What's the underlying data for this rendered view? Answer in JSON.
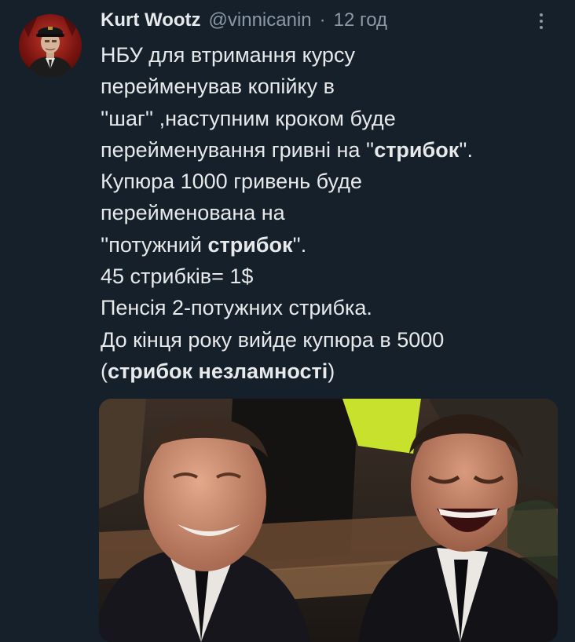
{
  "tweet": {
    "author_name": "Kurt Wootz",
    "handle": "@vinnicanin",
    "separator": "·",
    "time": "12 год",
    "more_icon": "more-vertical-icon",
    "lines": [
      {
        "parts": [
          {
            "text": "НБУ для втримання курсу",
            "bold": false
          }
        ]
      },
      {
        "parts": [
          {
            "text": "перейменував копійку в",
            "bold": false
          }
        ]
      },
      {
        "parts": [
          {
            "text": "''шаг'' ,наступним кроком буде",
            "bold": false
          }
        ]
      },
      {
        "parts": [
          {
            "text": "перейменування гривні на ''",
            "bold": false
          },
          {
            "text": "стрибок",
            "bold": true
          },
          {
            "text": "''.",
            "bold": false
          }
        ]
      },
      {
        "parts": [
          {
            "text": "Купюра 1000 гривень буде",
            "bold": false
          }
        ]
      },
      {
        "parts": [
          {
            "text": "перейменована на",
            "bold": false
          }
        ]
      },
      {
        "parts": [
          {
            "text": "''потужний ",
            "bold": false
          },
          {
            "text": "стрибок",
            "bold": true
          },
          {
            "text": "''.",
            "bold": false
          }
        ]
      },
      {
        "parts": [
          {
            "text": "45 стрибків= 1$",
            "bold": false
          }
        ]
      },
      {
        "parts": [
          {
            "text": "Пенсія 2-потужних стрибка.",
            "bold": false
          }
        ]
      },
      {
        "parts": [
          {
            "text": "До кінця року вийде купюра в 5000",
            "bold": false
          }
        ]
      },
      {
        "parts": [
          {
            "text": "(",
            "bold": false
          },
          {
            "text": "стрибок незламності",
            "bold": true
          },
          {
            "text": ")",
            "bold": false
          }
        ]
      }
    ]
  },
  "colors": {
    "background": "#15202b",
    "text": "#e7e9ea",
    "secondary_text": "#8b98a5"
  }
}
